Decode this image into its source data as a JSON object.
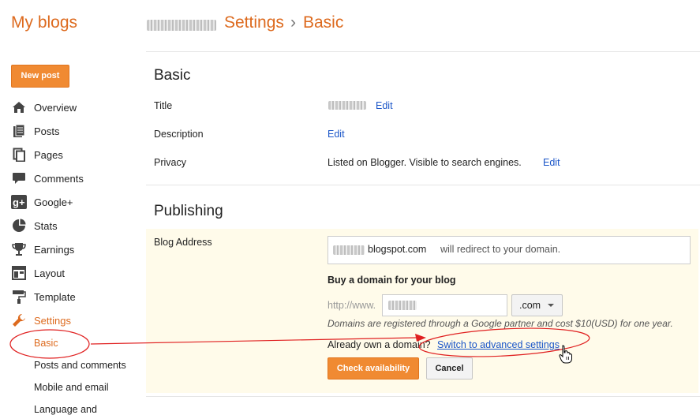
{
  "header": {
    "app_title": "My blogs",
    "breadcrumb_settings": "Settings",
    "breadcrumb_sep": "›",
    "breadcrumb_basic": "Basic"
  },
  "sidebar": {
    "new_post_label": "New post",
    "items": [
      {
        "label": "Overview",
        "icon": "home-icon"
      },
      {
        "label": "Posts",
        "icon": "posts-icon"
      },
      {
        "label": "Pages",
        "icon": "pages-icon"
      },
      {
        "label": "Comments",
        "icon": "comments-icon"
      },
      {
        "label": "Google+",
        "icon": "google-plus-icon"
      },
      {
        "label": "Stats",
        "icon": "stats-icon"
      },
      {
        "label": "Earnings",
        "icon": "earnings-icon"
      },
      {
        "label": "Layout",
        "icon": "layout-icon"
      },
      {
        "label": "Template",
        "icon": "template-icon"
      },
      {
        "label": "Settings",
        "icon": "wrench-icon"
      }
    ],
    "sub_items": [
      "Basic",
      "Posts and comments",
      "Mobile and email",
      "Language and"
    ]
  },
  "basic": {
    "section_title": "Basic",
    "title_label": "Title",
    "title_edit": "Edit",
    "description_label": "Description",
    "description_edit": "Edit",
    "privacy_label": "Privacy",
    "privacy_value": "Listed on Blogger. Visible to search engines.",
    "privacy_edit": "Edit"
  },
  "publishing": {
    "section_title": "Publishing",
    "blog_address_label": "Blog Address",
    "address_domain": "blogspot.com",
    "address_note": "will redirect to your domain.",
    "buy_domain_heading": "Buy a domain for your blog",
    "http_prefix": "http://www.",
    "tld_selected": ".com",
    "domains_note": "Domains are registered through a Google partner and cost $10(USD) for one year.",
    "already_own": "Already own a domain?",
    "switch_link": "Switch to advanced settings",
    "check_button": "Check availability",
    "cancel_button": "Cancel"
  },
  "colors": {
    "accent": "#dd6a1e",
    "button_orange": "#f08a32",
    "link_blue": "#1a55c8",
    "panel_bg": "#fffbea",
    "annotation_red": "#e02020"
  }
}
